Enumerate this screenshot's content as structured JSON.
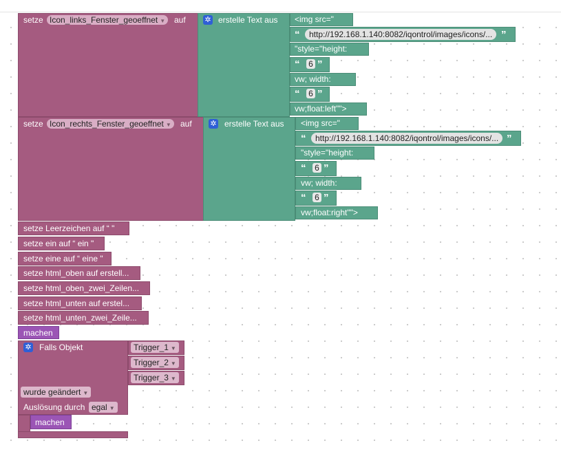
{
  "blocks": {
    "set1": {
      "keyword": "setze",
      "variable": "Icon_links_Fenster_geoeffnet",
      "to": "auf",
      "create_text": "erstelle Text aus",
      "items": [
        " <img src=\" ",
        "http://192.168.1.140:8082/iqontrol/images/icons/...",
        " \"style=\"height:  ",
        "6",
        " vw; width:  ",
        "6",
        " vw;float:left\"\"> "
      ]
    },
    "set2": {
      "keyword": "setze",
      "variable": "Icon_rechts_Fenster_geoeffnet",
      "to": "auf",
      "create_text": "erstelle Text aus",
      "items": [
        " <img src=\" ",
        "http://192.168.1.140:8082/iqontrol/images/icons/...",
        " \"style=\"height:  ",
        "6",
        " vw; width:  ",
        "6",
        " vw;float:right\"\"> "
      ]
    },
    "simple": [
      "setze Leerzeichen auf “   \"",
      "setze ein auf “ ein \"",
      "setze eine auf “ eine \"",
      "setze html_oben auf erstell...",
      "setze html_oben_zwei_Zeilen...",
      "setze html_unten auf erstel...",
      "setze html_unten_zwei_Zeile..."
    ],
    "do1": "machen",
    "event": {
      "title": "Falls Objekt",
      "triggers": [
        "Trigger_1",
        "Trigger_2",
        "Trigger_3"
      ],
      "condition": "wurde geändert",
      "cause_label": "Auslösung durch",
      "cause_value": "egal",
      "do": "machen"
    },
    "quote_open": "“",
    "quote_close": "”"
  },
  "colors": {
    "variable_block": "#a55b80",
    "text_block": "#5ba58c",
    "control_block": "#9b55b5"
  },
  "icons": {
    "gear": "gear-icon",
    "dropdown": "chevron-down-icon"
  }
}
